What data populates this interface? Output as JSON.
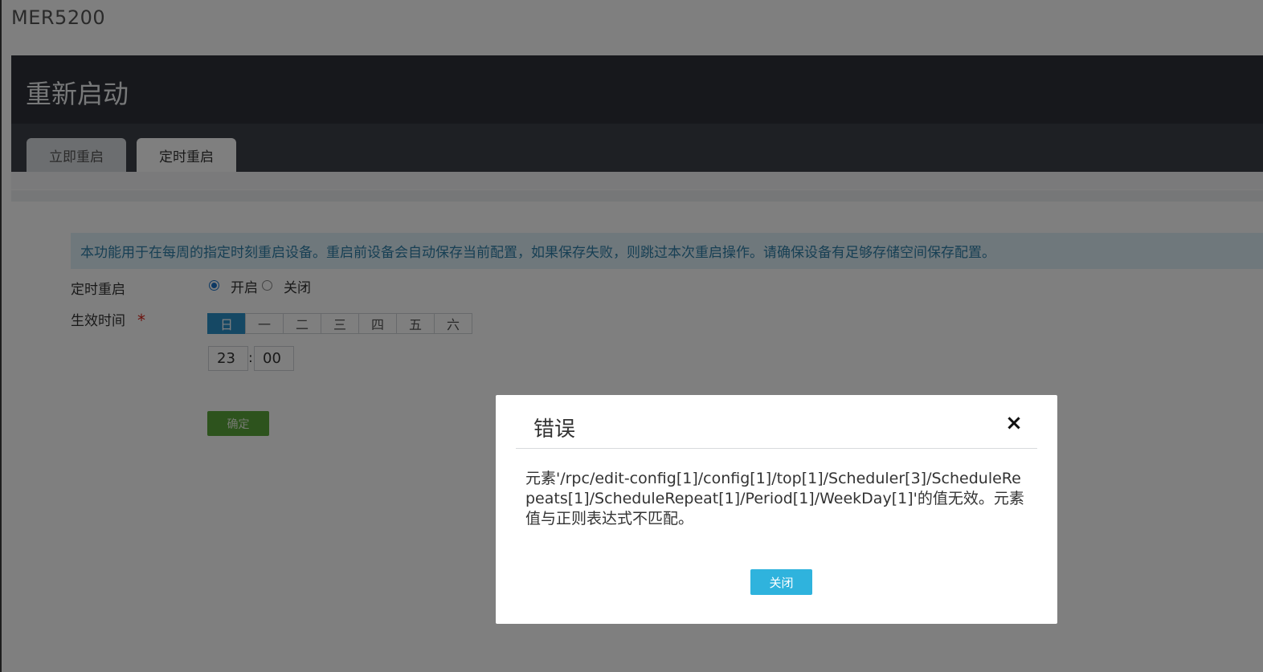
{
  "app": {
    "device_name": "MER5200",
    "page_title": "重新启动"
  },
  "tabs": [
    {
      "label": "立即重启"
    },
    {
      "label": "定时重启"
    }
  ],
  "form": {
    "info": "本功能用于在每周的指定时刻重启设备。重启前设备会自动保存当前配置，如果保存失败，则跳过本次重启操作。请确保设备有足够存储空间保存配置。",
    "timed_reboot_label": "定时重启",
    "option_on": "开启",
    "option_off": "关闭",
    "effective_time_label": "生效时间",
    "required_mark": "*",
    "days": [
      "日",
      "一",
      "二",
      "三",
      "四",
      "五",
      "六"
    ],
    "hour": "23",
    "minute": "00",
    "time_separator": ":",
    "confirm_label": "确定"
  },
  "dialog": {
    "title": "错误",
    "message": "元素'/rpc/edit-config[1]/config[1]/top[1]/Scheduler[3]/ScheduleRepeats[1]/ScheduleRepeat[1]/Period[1]/WeekDay[1]'的值无效。元素值与正则表达式不匹配。",
    "close_label": "关闭",
    "close_icon": "×"
  }
}
